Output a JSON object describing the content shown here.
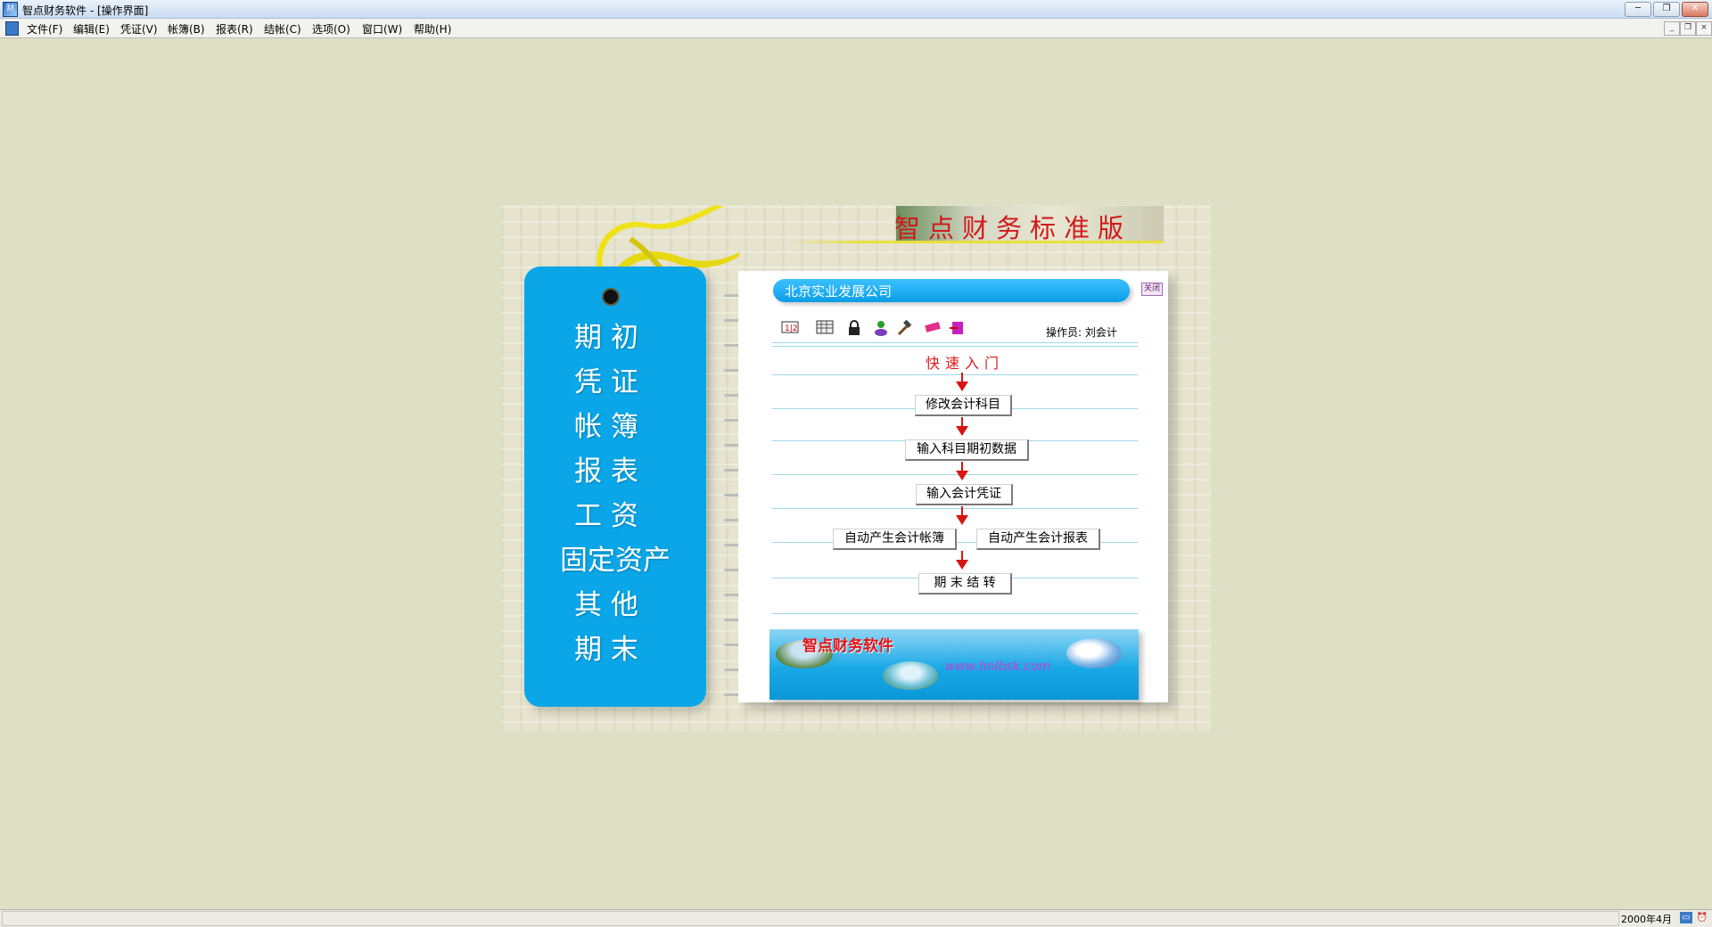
{
  "window": {
    "title": "智点财务软件 - [操作界面]",
    "app_icon": "app-icon",
    "controls": {
      "minimize": "─",
      "restore": "❐",
      "close": "✕"
    }
  },
  "menu": {
    "items": [
      "文件(F)",
      "编辑(E)",
      "凭证(V)",
      "帐簿(B)",
      "报表(R)",
      "结帐(C)",
      "选项(O)",
      "窗口(W)",
      "帮助(H)"
    ],
    "mdi_controls": {
      "minimize": "_",
      "restore": "❐",
      "close": "×"
    }
  },
  "brand": {
    "title": "智点财务标准版"
  },
  "sidebar": {
    "items": [
      "期 初",
      "凭 证",
      "帐 簿",
      "报 表",
      "工 资",
      "固定资产",
      "其 他",
      "期 末"
    ]
  },
  "page": {
    "company": "北京实业发展公司",
    "close_label": "关闭",
    "operator": "操作员: 刘会计",
    "toolbar_icons": [
      "calculator-icon",
      "calendar-icon",
      "lock-icon",
      "user-icon",
      "hammer-icon",
      "eraser-icon",
      "exit-icon"
    ],
    "quick_start_title": "快速入门",
    "steps": {
      "modify_accounts": "修改会计科目",
      "input_opening": "输入科目期初数据",
      "input_voucher": "输入会计凭证",
      "auto_books": "自动产生会计帐簿",
      "auto_reports": "自动产生会计报表",
      "period_end": "期 末 结 转"
    }
  },
  "banner": {
    "brand": "智点财务软件",
    "url": "www.hnlbsk.com"
  },
  "status": {
    "date": "2000年4月"
  },
  "colors": {
    "background": "#dde0c5",
    "bookmark": "#0aa6e8",
    "accent_red": "#d91414",
    "company_bar": "#0a9ee6"
  }
}
